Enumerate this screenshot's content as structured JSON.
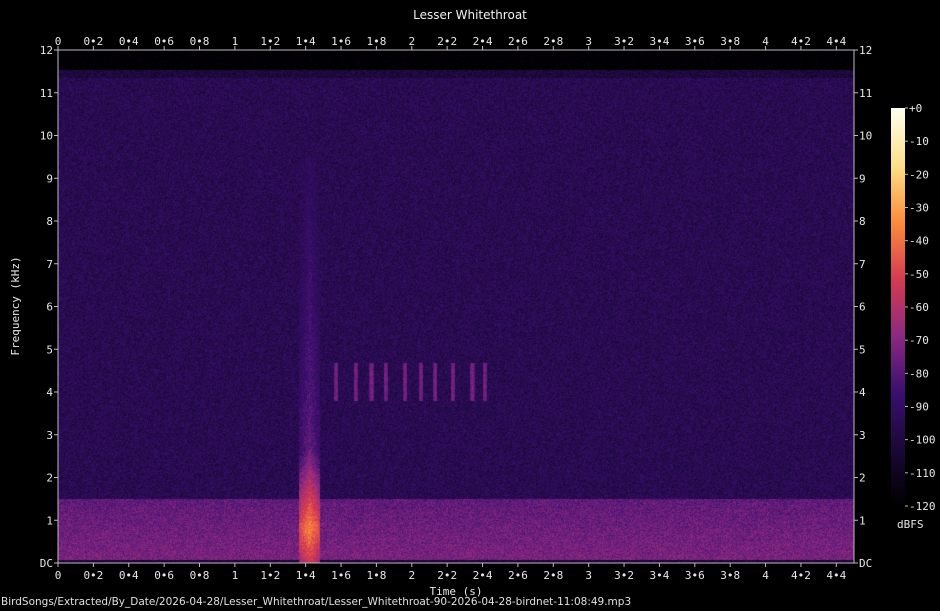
{
  "chart_data": {
    "type": "heatmap",
    "title": "Lesser Whitethroat",
    "xlabel": "Time (s)",
    "ylabel": "Frequency (kHz)",
    "xlim": [
      0,
      4.5
    ],
    "ylim": [
      0,
      12
    ],
    "x_ticks": [
      "0",
      "0•2",
      "0•4",
      "0•6",
      "0•8",
      "1",
      "1•2",
      "1•4",
      "1•6",
      "1•8",
      "2",
      "2•2",
      "2•4",
      "2•6",
      "2•8",
      "3",
      "3•2",
      "3•4",
      "3•6",
      "3•8",
      "4",
      "4•2",
      "4•4"
    ],
    "y_ticks": [
      "DC",
      "1",
      "2",
      "3",
      "4",
      "5",
      "6",
      "7",
      "8",
      "9",
      "10",
      "11",
      "12"
    ],
    "colorbar": {
      "label": "dBFS",
      "ticks": [
        "+0",
        "-10",
        "-20",
        "-30",
        "-40",
        "-50",
        "-60",
        "-70",
        "-80",
        "-90",
        "-100",
        "-110",
        "-120"
      ],
      "range": [
        -120,
        0
      ],
      "colors": [
        "#000000",
        "#1a0838",
        "#3b0f70",
        "#8c2981",
        "#d63b51",
        "#fc8d3a",
        "#fde089",
        "#fffff0"
      ]
    },
    "background_level_dbfs": -95,
    "low_band": {
      "freq_khz": [
        0,
        1.5
      ],
      "level_dbfs": -78
    },
    "events": [
      {
        "name": "broadband transient",
        "t_s": [
          1.36,
          1.48
        ],
        "freq_khz": [
          0.1,
          9.5
        ],
        "peak_dbfs": -35,
        "peak_freq_khz": 0.8
      },
      {
        "name": "song notes",
        "t_s": [
          1.56,
          2.42
        ],
        "freq_khz": [
          3.8,
          4.7
        ],
        "notes_t_s": [
          1.57,
          1.68,
          1.77,
          1.85,
          1.96,
          2.05,
          2.13,
          2.23,
          2.34,
          2.41
        ]
      }
    ]
  },
  "footer_path": "BirdSongs/Extracted/By_Date/2026-04-28/Lesser_Whitethroat/Lesser_Whitethroat-90-2026-04-28-birdnet-11:08:49.mp3"
}
